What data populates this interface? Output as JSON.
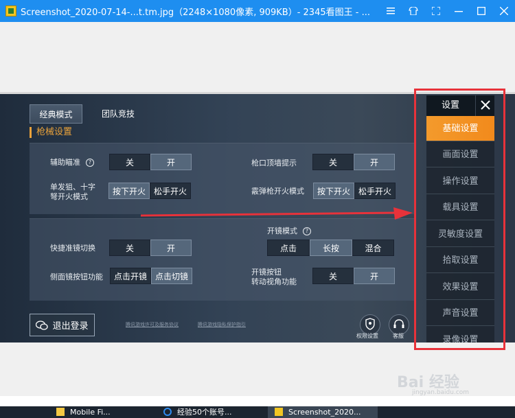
{
  "window": {
    "title": "Screenshot_2020-07-14-...t.tm.jpg（2248×1080像素, 909KB）- 2345看图王 - ..."
  },
  "game": {
    "tabs": [
      "经典模式",
      "团队竞技"
    ],
    "section_title": "枪械设置",
    "rows": {
      "aim_assist": {
        "label": "辅助瞄准",
        "help": "?",
        "options": [
          "关",
          "开"
        ],
        "selected": "开"
      },
      "muzzle_hint": {
        "label": "枪口顶墙提示",
        "options": [
          "关",
          "开"
        ],
        "selected": "开"
      },
      "single_fire": {
        "label_line1": "单发狙、十字",
        "label_line2": "弩开火模式",
        "options": [
          "按下开火",
          "松手开火"
        ],
        "selected": "按下开火"
      },
      "shotgun_fire": {
        "label": "霰弹枪开火模式",
        "options": [
          "按下开火",
          "松手开火"
        ],
        "selected": "按下开火"
      },
      "scope_mode": {
        "label": "开镜模式",
        "help": "?",
        "options": [
          "点击",
          "长按",
          "混合"
        ],
        "selected": "长按"
      },
      "quick_scope": {
        "label": "快捷准镜切换",
        "options": [
          "关",
          "开"
        ],
        "selected": "开"
      },
      "side_scope": {
        "label": "侧面镜按钮功能",
        "options": [
          "点击开镜",
          "点击切镜"
        ],
        "selected": "点击切镜"
      },
      "scope_view": {
        "label_line1": "开镜按钮",
        "label_line2": "转动视角功能",
        "options": [
          "关",
          "开"
        ],
        "selected": "开"
      }
    },
    "logout_label": "退出登录",
    "footer_links": [
      "腾讯游戏许可及服务协议",
      "腾讯游戏隐私保护指引"
    ],
    "bottom_buttons": [
      {
        "label": "权限设置",
        "icon": "shield-location-icon"
      },
      {
        "label": "客服",
        "icon": "headset-icon"
      }
    ]
  },
  "settings_menu": {
    "title": "设置",
    "items": [
      "基础设置",
      "画面设置",
      "操作设置",
      "载具设置",
      "灵敏度设置",
      "拾取设置",
      "效果设置",
      "声音设置",
      "录像设置"
    ],
    "active": "基础设置"
  },
  "watermark": {
    "main": "Bai 经验",
    "sub": "jingyan.baidu.com"
  },
  "taskbar": {
    "items": [
      "Mobile Fi...",
      "经验50个账号...",
      "Screenshot_2020..."
    ]
  },
  "colors": {
    "accent": "#f28a1c",
    "highlight_box": "#e8323a",
    "titlebar": "#1e8ef0"
  }
}
